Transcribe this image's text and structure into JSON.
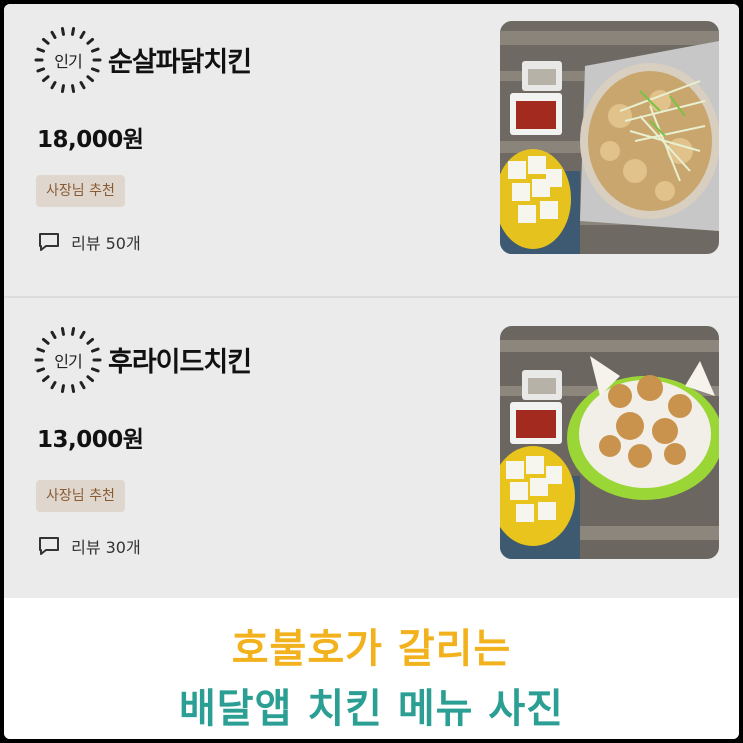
{
  "menu": {
    "items": [
      {
        "badge": "인기",
        "name": "순살파닭치킨",
        "price": "18,000원",
        "tag": "사장님 추천",
        "review": "리뷰 50개",
        "image": "fried-chicken-with-scallions-photo"
      },
      {
        "badge": "인기",
        "name": "후라이드치킨",
        "price": "13,000원",
        "tag": "사장님 추천",
        "review": "리뷰 30개",
        "image": "fried-chicken-photo"
      }
    ]
  },
  "banner": {
    "line1": "호불호가 갈리는",
    "line2": "배달앱 치킨 메뉴 사진"
  },
  "colors": {
    "banner_line1": "#f2b21d",
    "banner_line2": "#2b9f93",
    "tag_bg": "#dfd7cd",
    "tag_text": "#8a5a33"
  }
}
